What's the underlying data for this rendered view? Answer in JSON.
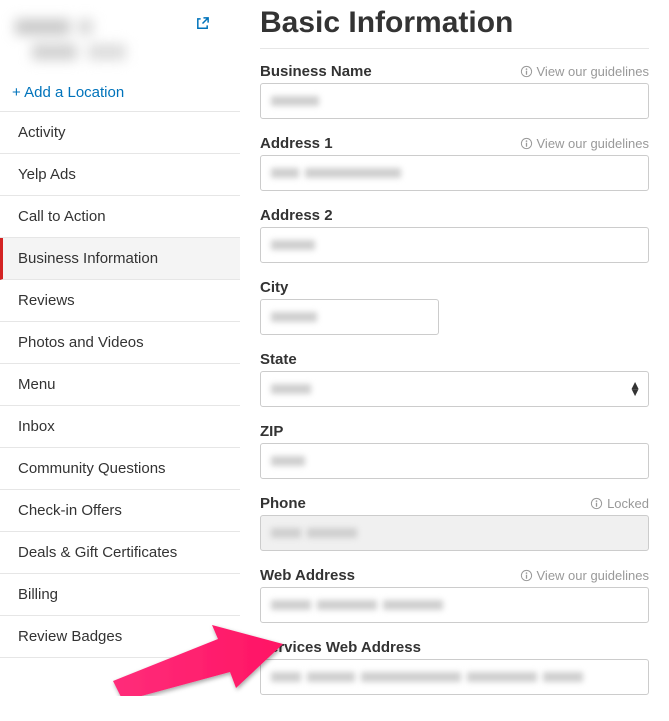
{
  "sidebar": {
    "add_location": "Add a Location",
    "items": [
      {
        "label": "Activity"
      },
      {
        "label": "Yelp Ads"
      },
      {
        "label": "Call to Action"
      },
      {
        "label": "Business Information"
      },
      {
        "label": "Reviews"
      },
      {
        "label": "Photos and Videos"
      },
      {
        "label": "Menu"
      },
      {
        "label": "Inbox"
      },
      {
        "label": "Community Questions"
      },
      {
        "label": "Check-in Offers"
      },
      {
        "label": "Deals & Gift Certificates"
      },
      {
        "label": "Billing"
      },
      {
        "label": "Review Badges"
      }
    ],
    "active_index": 3
  },
  "page_title": "Basic Information",
  "guidelines_text": "View our guidelines",
  "locked_text": "Locked",
  "fields": {
    "business_name": {
      "label": "Business Name",
      "hint": "guidelines",
      "width": "full"
    },
    "address1": {
      "label": "Address 1",
      "hint": "guidelines",
      "width": "full"
    },
    "address2": {
      "label": "Address 2",
      "hint": null,
      "width": "full"
    },
    "city": {
      "label": "City",
      "hint": null,
      "width": "half"
    },
    "state": {
      "label": "State",
      "hint": null,
      "width": "full",
      "type": "select"
    },
    "zip": {
      "label": "ZIP",
      "hint": null,
      "width": "full"
    },
    "phone": {
      "label": "Phone",
      "hint": "locked",
      "width": "full",
      "locked": true
    },
    "web": {
      "label": "Web Address",
      "hint": "guidelines",
      "width": "full"
    },
    "services_web": {
      "label": "Services Web Address",
      "hint": null,
      "width": "full"
    }
  }
}
